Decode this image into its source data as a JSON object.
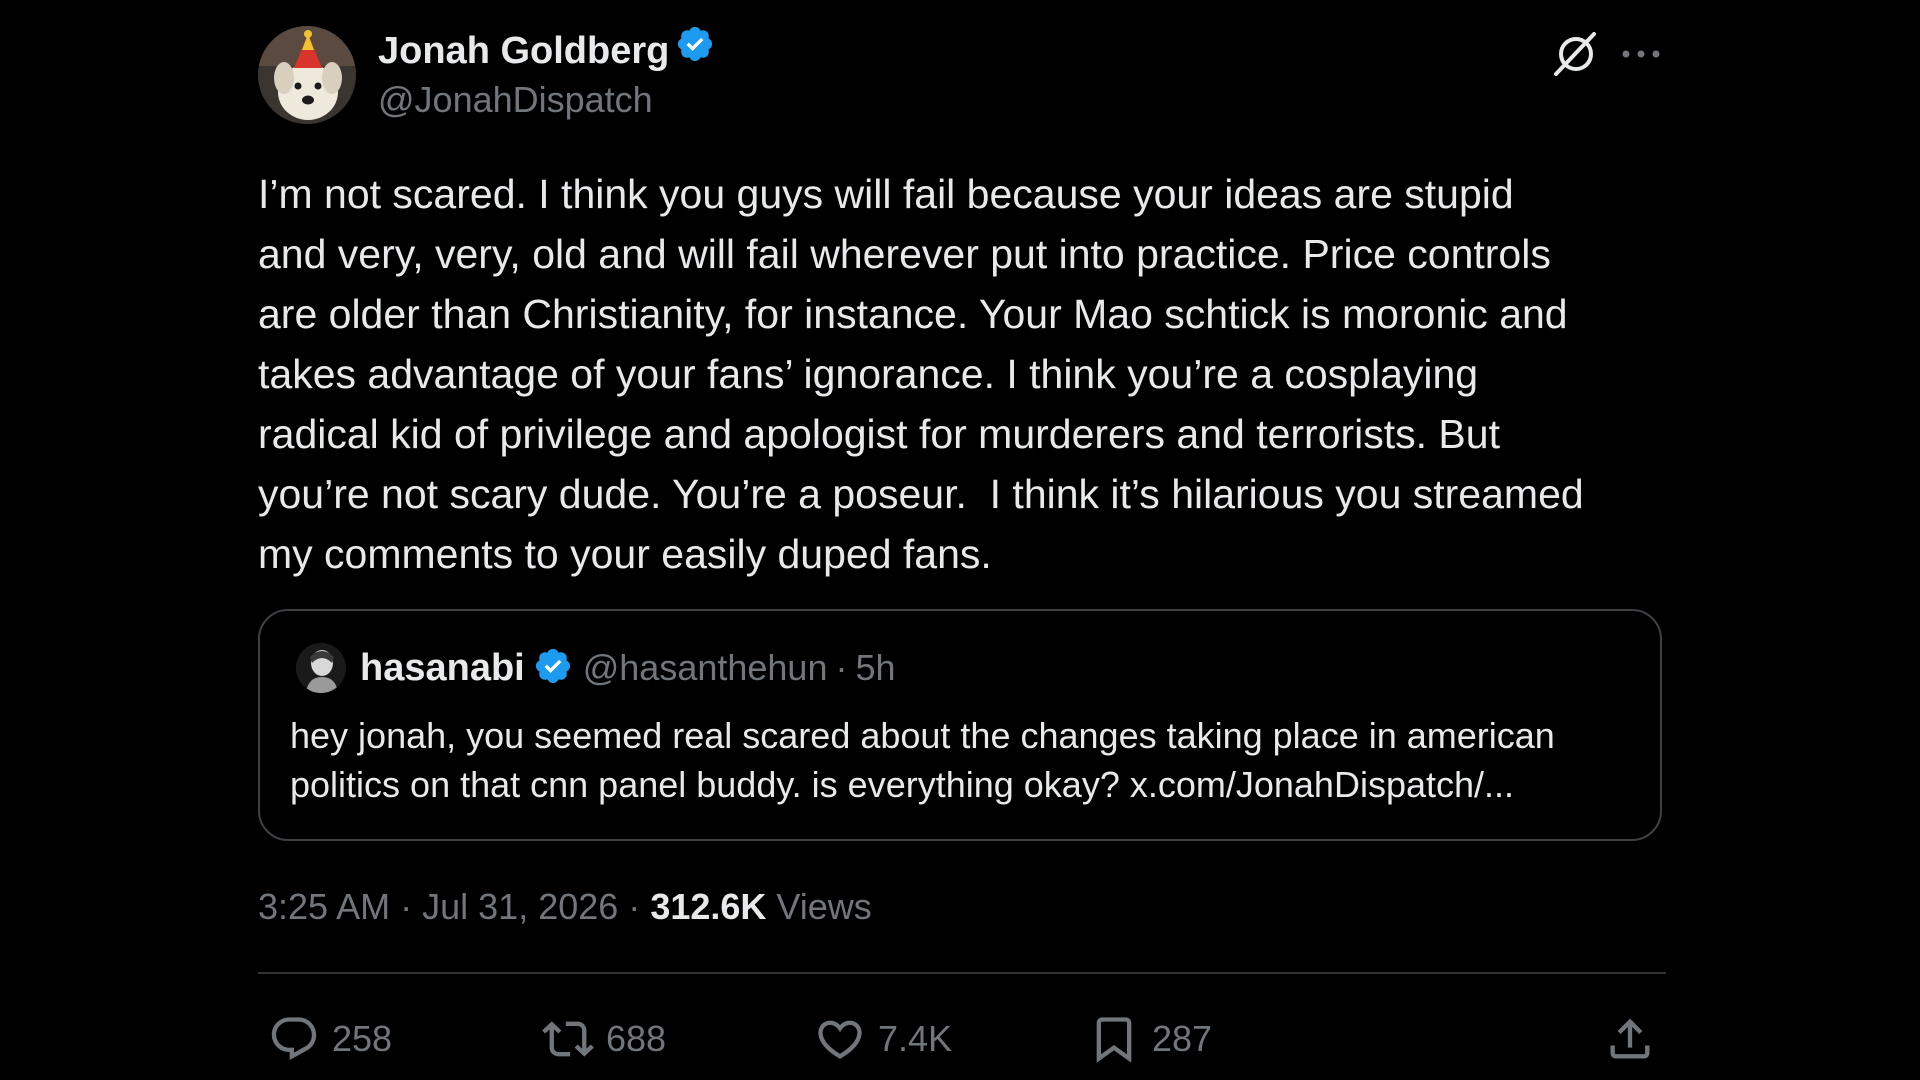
{
  "author": {
    "name": "Jonah Goldberg",
    "handle": "@JonahDispatch",
    "verified": true
  },
  "tweet": {
    "text": "I’m not scared. I think you guys will fail because your ideas are stupid\nand very, very, old and will fail wherever put into practice. Price controls\nare older than Christianity, for instance. Your Mao schtick is moronic and\ntakes advantage of your fans’ ignorance. I think you’re a cosplaying\nradical kid of privilege and apologist for murderers and terrorists. But\nyou’re not scary dude. You’re a poseur.  I think it’s hilarious you streamed\nmy comments to your easily duped fans."
  },
  "quote": {
    "name": "hasanabi",
    "handle": "@hasanthehun",
    "separator": "·",
    "time": "5h",
    "text": "hey jonah, you seemed real scared about the changes taking place in american politics on that cnn panel buddy. is everything okay? x.com/JonahDispatch/..."
  },
  "meta": {
    "time": "3:25 AM",
    "separator": "·",
    "date": "Jul 31, 2026",
    "views_count": "312.6K",
    "views_label": "Views"
  },
  "actions": {
    "replies": "258",
    "reposts": "688",
    "likes": "7.4K",
    "bookmarks": "287"
  },
  "icons": {
    "verified": "verified-badge-icon",
    "grok": "grok-icon",
    "more": "more-icon",
    "reply": "reply-icon",
    "repost": "repost-icon",
    "like": "heart-icon",
    "bookmark": "bookmark-icon",
    "share": "share-icon"
  },
  "colors": {
    "background": "#000000",
    "text_primary": "#e7e9ea",
    "text_secondary": "#71767b",
    "verified_blue": "#1d9bf0",
    "border": "#3e4144"
  }
}
